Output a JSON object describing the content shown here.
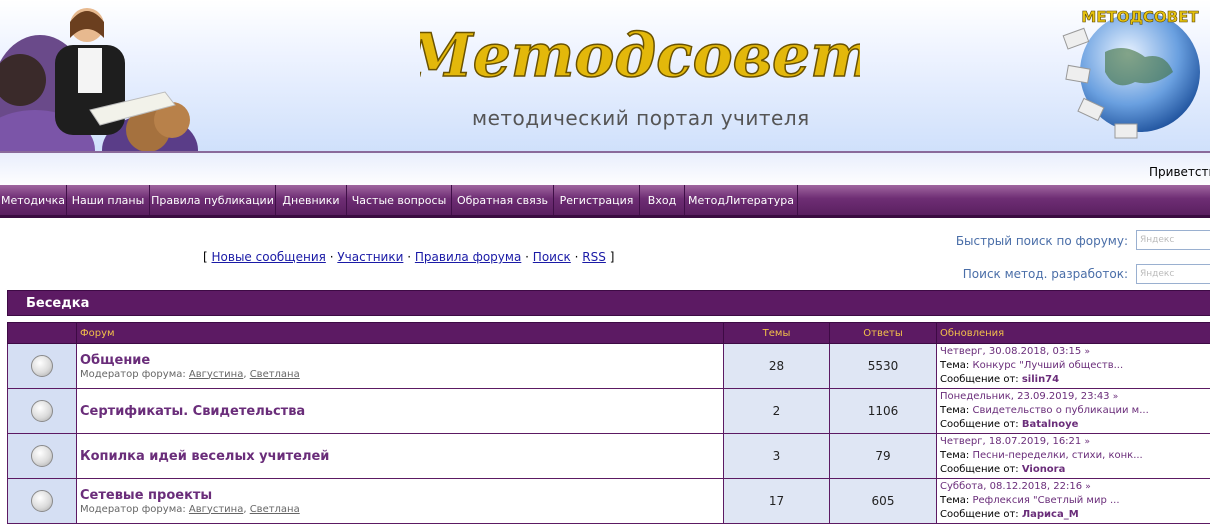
{
  "header": {
    "logo_text": "Методсовет",
    "subtitle": "методический портал учителя",
    "globe_logo_text": "МЕТОДСОВЕТ",
    "welcome": "Приветств"
  },
  "menu": [
    {
      "label": "Методичка"
    },
    {
      "label": "Наши планы"
    },
    {
      "label": "Правила публикации"
    },
    {
      "label": "Дневники"
    },
    {
      "label": "Частые вопросы"
    },
    {
      "label": "Обратная связь"
    },
    {
      "label": "Регистрация"
    },
    {
      "label": "Вход"
    },
    {
      "label": "МетодЛитература"
    }
  ],
  "forum_links": {
    "open": "[",
    "close": "]",
    "sep": "·",
    "new_posts": "Новые сообщения",
    "members": "Участники",
    "rules": "Правила форума",
    "search": "Поиск",
    "rss": "RSS"
  },
  "search": {
    "forum_label": "Быстрый поиск по форуму:",
    "forum_placeholder": "Яндекс",
    "method_label": "Поиск метод. разработок:",
    "method_placeholder": "Яндекс"
  },
  "category": {
    "title": "Беседка"
  },
  "table_headers": {
    "forum": "Форум",
    "topics": "Темы",
    "posts": "Ответы",
    "updates": "Обновления"
  },
  "forums": [
    {
      "name": "Общение",
      "moderator_label": "Модератор форума:",
      "moderators": [
        "Августина",
        "Светлана"
      ],
      "moderator_sep": ", ",
      "topics": "28",
      "posts": "5530",
      "last_date": "Четверг, 30.08.2018, 03:15",
      "topic_label": "Тема:",
      "last_topic": "Конкурс \"Лучший обществ...",
      "by_label": "Сообщение от:",
      "last_author": "silin74"
    },
    {
      "name": "Сертификаты. Свидетельства",
      "topics": "2",
      "posts": "1106",
      "last_date": "Понедельник, 23.09.2019, 23:43",
      "topic_label": "Тема:",
      "last_topic": "Свидетельство о публикации м...",
      "by_label": "Сообщение от:",
      "last_author": "Batalnoye"
    },
    {
      "name": "Копилка идей веселых учителей",
      "topics": "3",
      "posts": "79",
      "last_date": "Четверг, 18.07.2019, 16:21",
      "topic_label": "Тема:",
      "last_topic": "Песни-переделки, стихи, конк...",
      "by_label": "Сообщение от:",
      "last_author": "Vionora"
    },
    {
      "name": "Сетевые проекты",
      "moderator_label": "Модератор форума:",
      "moderators": [
        "Августина",
        "Светлана"
      ],
      "moderator_sep": ", ",
      "topics": "17",
      "posts": "605",
      "last_date": "Суббота, 08.12.2018, 22:16",
      "topic_label": "Тема:",
      "last_topic": "Рефлексия \"Светлый мир ...",
      "by_label": "Сообщение от:",
      "last_author": "Лариса_М"
    }
  ],
  "icons": {
    "status": "forum-status-icon",
    "arrow": "go-to-last-post-icon"
  },
  "colors": {
    "menu": "#6e2e74",
    "header_row": "#5c1a63",
    "header_text": "#f3c14a",
    "link": "#6a2d7a"
  }
}
